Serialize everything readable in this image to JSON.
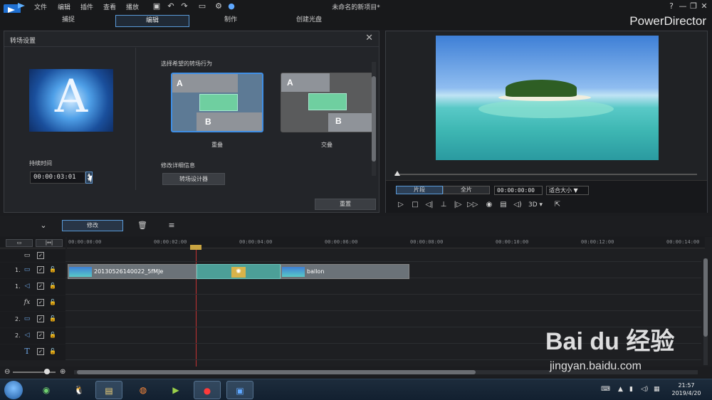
{
  "app": {
    "menu": [
      "文件",
      "编辑",
      "插件",
      "查看",
      "播放"
    ],
    "window_title": "未命名的新项目*",
    "brand": "PowerDirector",
    "window_controls": [
      "?",
      "—",
      "❐",
      "✕"
    ]
  },
  "modes": [
    {
      "label": "捕捉",
      "active": false
    },
    {
      "label": "编辑",
      "active": true
    },
    {
      "label": "制作",
      "active": false
    },
    {
      "label": "创建光盘",
      "active": false
    }
  ],
  "settings": {
    "title": "转场设置",
    "close_icon": "close-icon",
    "thumb_letter": "A",
    "duration_label": "持续时间",
    "duration_value": "00:00:03:01",
    "behavior_label": "选择希望的转场行为",
    "options": [
      {
        "name": "重叠",
        "selected": true,
        "clip_a": "A",
        "clip_b": "B"
      },
      {
        "name": "交叠",
        "selected": false,
        "clip_a": "A",
        "clip_b": "B"
      }
    ],
    "modify_label": "修改详细信息",
    "designer_button": "转场设计器",
    "reset_button": "重置"
  },
  "preview": {
    "segment_clip": "片段",
    "segment_full": "全片",
    "timecode": "00:00:00:00",
    "fit": "适合大小 ▼",
    "three_d": "3D ▾",
    "controls": [
      "play-icon",
      "stop-icon",
      "prev-frame-icon",
      "split-icon",
      "next-frame-icon",
      "fast-forward-icon",
      "snapshot-icon",
      "subtitle-icon",
      "volume-icon",
      "3d-icon",
      "undock-icon"
    ]
  },
  "timeline_toolbar": {
    "modify_button": "修改"
  },
  "timeline": {
    "ruler_labels": [
      "00:00:00:00",
      "00:00:02:00",
      "00:00:04:00",
      "00:00:06:00",
      "00:00:08:00",
      "00:00:10:00",
      "00:00:12:00",
      "00:00:14:00"
    ],
    "tracks": [
      {
        "num": "",
        "icon": "▭"
      },
      {
        "num": "1.",
        "icon": "▭"
      },
      {
        "num": "1.",
        "icon": "◁"
      },
      {
        "num": "",
        "icon": "fx"
      },
      {
        "num": "2.",
        "icon": "▭"
      },
      {
        "num": "2.",
        "icon": "◁"
      },
      {
        "num": "",
        "icon": "T"
      }
    ],
    "clips": [
      {
        "label": "20130526140022_5fMJe"
      },
      {
        "label": "ballon"
      }
    ]
  },
  "taskbar": {
    "time": "21:57",
    "date": "2019/4/20"
  },
  "watermark": {
    "logo": "Bai du 经验",
    "url": "jingyan.baidu.com"
  }
}
